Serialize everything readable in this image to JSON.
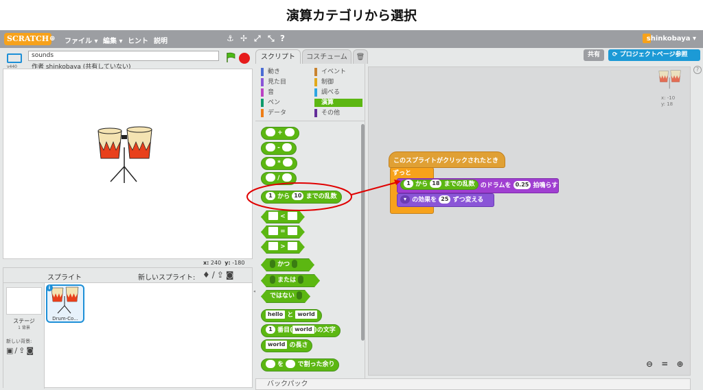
{
  "slide_title": "演算カテゴリから選択",
  "menubar": {
    "logo": "SCRATCH",
    "items": [
      "ファイル ▾",
      "編集 ▾",
      "ヒント",
      "説明"
    ],
    "user": "shinkobaya ▾"
  },
  "stage": {
    "project_name": "sounds",
    "author": "作者 shinkobaya (共有していない)",
    "version": "v440",
    "x_label": "x:",
    "x_value": "240",
    "y_label": "y:",
    "y_value": "-180"
  },
  "tabs": [
    "スクリプト",
    "コスチューム",
    "🗑"
  ],
  "top_buttons": {
    "share": "共有",
    "project_page": "プロジェクトページ参照"
  },
  "categories": [
    {
      "label": "動き",
      "color": "#4a6cd4"
    },
    {
      "label": "イベント",
      "color": "#c88330"
    },
    {
      "label": "見た目",
      "color": "#8a55d7"
    },
    {
      "label": "制御",
      "color": "#e1a91a"
    },
    {
      "label": "音",
      "color": "#bb42c3"
    },
    {
      "label": "調べる",
      "color": "#2ca5e2"
    },
    {
      "label": "ペン",
      "color": "#0e9a6c"
    },
    {
      "label": "演算",
      "color": "#5cb712",
      "selected": true
    },
    {
      "label": "データ",
      "color": "#ee7d16"
    },
    {
      "label": "その他",
      "color": "#632d99"
    }
  ],
  "palette_blocks": {
    "ops": [
      "+",
      "-",
      "*",
      "/"
    ],
    "random": {
      "a": "1",
      "mid": "から",
      "b": "10",
      "end": "までの乱数"
    },
    "compare": [
      "<",
      "=",
      ">"
    ],
    "logic": [
      "かつ",
      "または",
      "ではない"
    ],
    "join": {
      "a": "hello",
      "mid": "と",
      "b": "world"
    },
    "letter": {
      "a": "1",
      "mid": "番目(",
      "b": "world",
      "end": ")の文字"
    },
    "length": {
      "a": "world",
      "end": "の長さ"
    },
    "mod": {
      "mid": "を",
      "end": "で割った余り"
    }
  },
  "script": {
    "hat": "このスプライトがクリックされたとき",
    "forever": "ずっと",
    "random": {
      "a": "1",
      "mid": "から",
      "b": "18",
      "end": "までの乱数"
    },
    "play_drum": {
      "pre": "のドラムを",
      "beats": "0.25",
      "post": "拍鳴らす"
    },
    "effect": {
      "mid": "の効果を",
      "val": "25",
      "post": "ずつ変える"
    }
  },
  "sprite_info": {
    "x": "x: -10",
    "y": "y: 18"
  },
  "sprite_pane": {
    "title": "スプライト",
    "new_sprite": "新しいスプライト:",
    "stage_label": "ステージ",
    "stage_sub": "1 背景",
    "new_backdrop": "新しい背景:",
    "sprite_name": "Drum-Co..."
  },
  "backpack": "バックパック",
  "zoom": "⊖ = ⊕"
}
